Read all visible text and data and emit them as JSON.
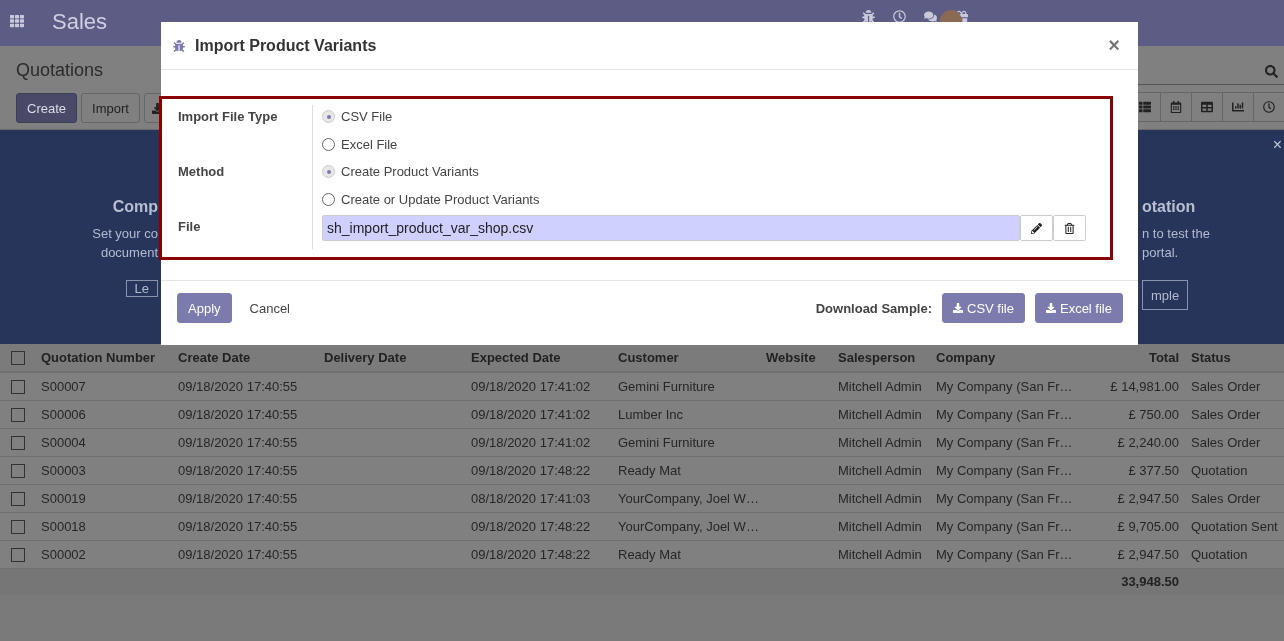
{
  "navbar": {
    "app": "Sales"
  },
  "control_panel": {
    "title": "Quotations",
    "buttons": [
      "Create",
      "Import"
    ]
  },
  "banner": {
    "left": {
      "title": "Comp",
      "lines": [
        "Set your co",
        "document"
      ],
      "button": "Le"
    },
    "right": {
      "title": "otation",
      "lines": [
        "n to test the",
        "portal."
      ],
      "button": "mple"
    },
    "close": "×"
  },
  "table": {
    "all_checked": false,
    "columns": [
      "Quotation Number",
      "Create Date",
      "Delivery Date",
      "Expected Date",
      "Customer",
      "Website",
      "Salesperson",
      "Company",
      "Total",
      "Status"
    ],
    "rows": [
      {
        "checked": false,
        "cells": [
          "S00007",
          "09/18/2020 17:40:55",
          "",
          "09/18/2020 17:41:02",
          "Gemini Furniture",
          "",
          "Mitchell Admin",
          "My Company (San Fr…",
          "£ 14,981.00",
          "Sales Order"
        ]
      },
      {
        "checked": false,
        "cells": [
          "S00006",
          "09/18/2020 17:40:55",
          "",
          "09/18/2020 17:41:02",
          "Lumber Inc",
          "",
          "Mitchell Admin",
          "My Company (San Fr…",
          "£ 750.00",
          "Sales Order"
        ]
      },
      {
        "checked": false,
        "cells": [
          "S00004",
          "09/18/2020 17:40:55",
          "",
          "09/18/2020 17:41:02",
          "Gemini Furniture",
          "",
          "Mitchell Admin",
          "My Company (San Fr…",
          "£ 2,240.00",
          "Sales Order"
        ]
      },
      {
        "checked": false,
        "cells": [
          "S00003",
          "09/18/2020 17:40:55",
          "",
          "09/18/2020 17:48:22",
          "Ready Mat",
          "",
          "Mitchell Admin",
          "My Company (San Fr…",
          "£ 377.50",
          "Quotation"
        ]
      },
      {
        "checked": false,
        "cells": [
          "S00019",
          "09/18/2020 17:40:55",
          "",
          "08/18/2020 17:41:03",
          "YourCompany, Joel W…",
          "",
          "Mitchell Admin",
          "My Company (San Fr…",
          "£ 2,947.50",
          "Sales Order"
        ]
      },
      {
        "checked": false,
        "cells": [
          "S00018",
          "09/18/2020 17:40:55",
          "",
          "09/18/2020 17:48:22",
          "YourCompany, Joel W…",
          "",
          "Mitchell Admin",
          "My Company (San Fr…",
          "£ 9,705.00",
          "Quotation Sent"
        ]
      },
      {
        "checked": false,
        "cells": [
          "S00002",
          "09/18/2020 17:40:55",
          "",
          "09/18/2020 17:48:22",
          "Ready Mat",
          "",
          "Mitchell Admin",
          "My Company (San Fr…",
          "£ 2,947.50",
          "Quotation"
        ]
      }
    ],
    "total": "33,948.50"
  },
  "modal": {
    "title": "Import Product Variants",
    "close": "×",
    "fields": [
      {
        "label": "Import File Type",
        "kind": "radio",
        "options": [
          {
            "label": "CSV File",
            "selected": true
          },
          {
            "label": "Excel File",
            "selected": false
          }
        ]
      },
      {
        "label": "Method",
        "kind": "radio",
        "options": [
          {
            "label": "Create Product Variants",
            "selected": true
          },
          {
            "label": "Create or Update Product Variants",
            "selected": false
          }
        ]
      },
      {
        "label": "File",
        "kind": "file",
        "value": "sh_import_product_var_shop.csv"
      }
    ],
    "apply": "Apply",
    "cancel": "Cancel",
    "download_label": "Download Sample:",
    "downloads": [
      "CSV file",
      "Excel file"
    ]
  }
}
